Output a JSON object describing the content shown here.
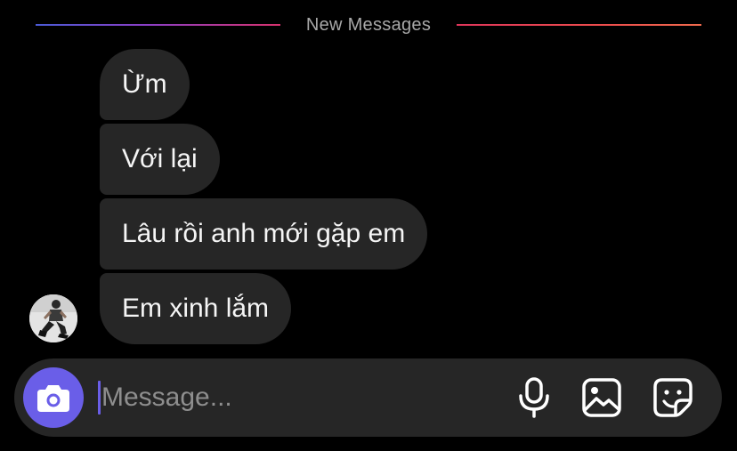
{
  "divider": {
    "label": "New Messages"
  },
  "messages": [
    {
      "text": "Ừm"
    },
    {
      "text": "Với lại"
    },
    {
      "text": "Lâu rồi anh mới gặp em"
    },
    {
      "text": "Em xinh lắm"
    }
  ],
  "composer": {
    "placeholder": "Message...",
    "camera_icon": "camera-icon",
    "mic_icon": "microphone-icon",
    "gallery_icon": "image-icon",
    "sticker_icon": "sticker-icon"
  },
  "colors": {
    "background": "#000000",
    "bubble": "#262626",
    "accent": "#6a5ee8",
    "divider_text": "#a8a8a8"
  }
}
